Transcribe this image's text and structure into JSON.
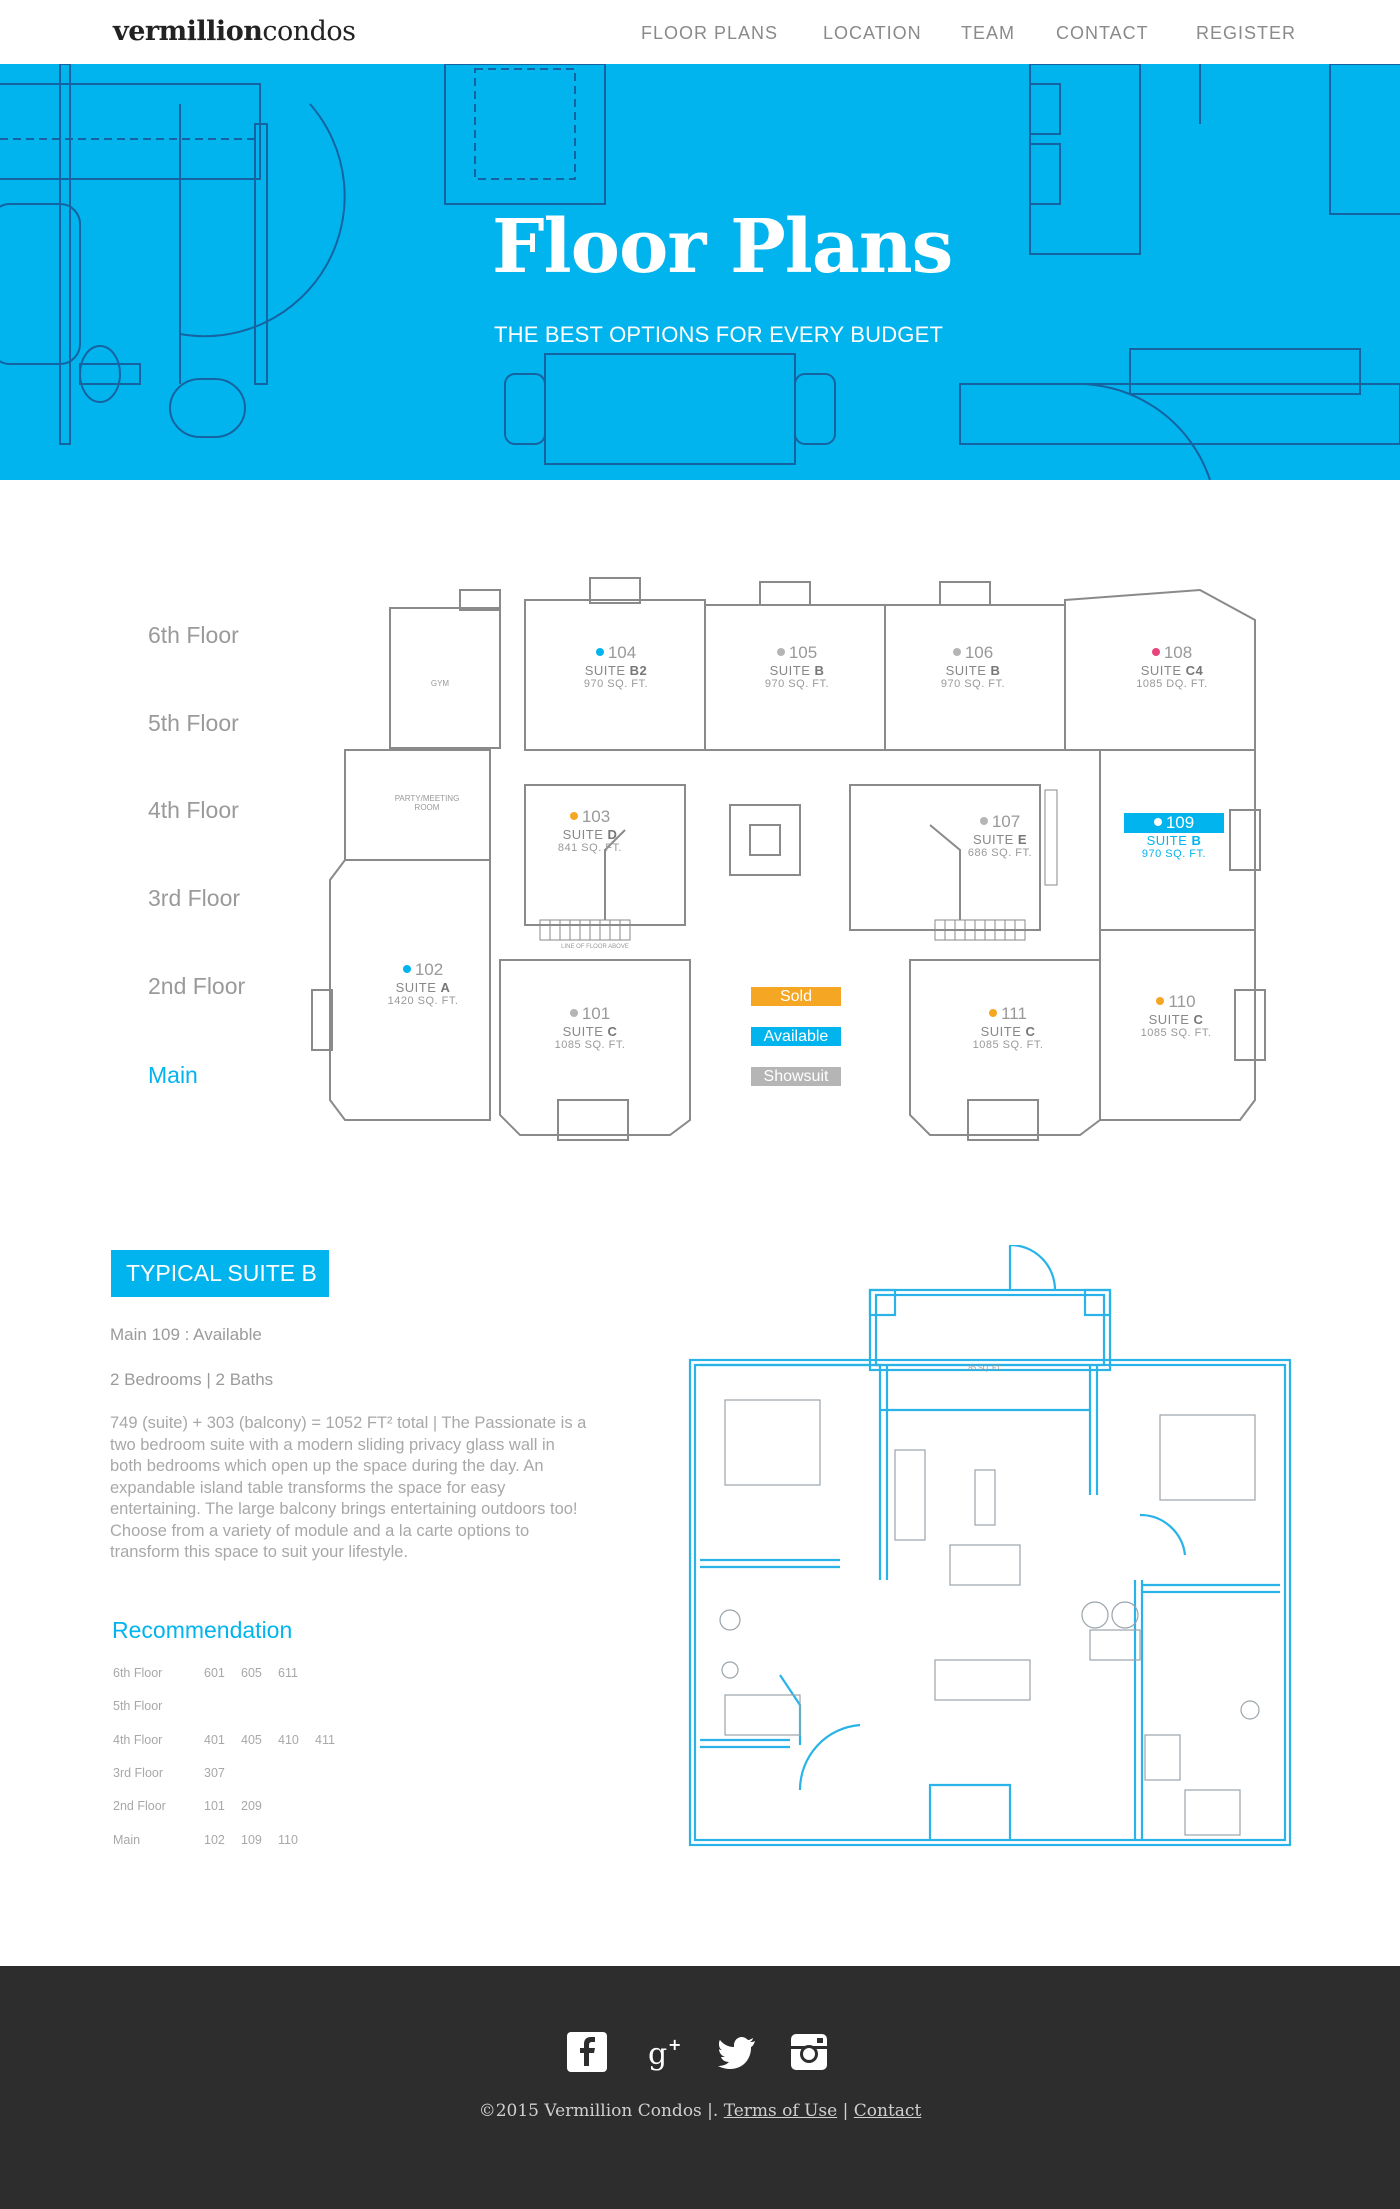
{
  "brand": {
    "logo_bold": "vermillion",
    "logo_light": "condos"
  },
  "nav": [
    {
      "label": "FLOOR PLANS"
    },
    {
      "label": "LOCATION"
    },
    {
      "label": "TEAM"
    },
    {
      "label": "CONTACT"
    },
    {
      "label": "REGISTER"
    }
  ],
  "hero": {
    "title": "Floor Plans",
    "subtitle": "THE BEST OPTIONS FOR EVERY BUDGET"
  },
  "floors": [
    "6th Floor",
    "5th Floor",
    "4th Floor",
    "3rd Floor",
    "2nd Floor",
    "Main"
  ],
  "active_floor": "Main",
  "units": [
    {
      "num": "104",
      "suite_prefix": "SUITE ",
      "suite_letter": "B2",
      "sq": "970 SQ. FT.",
      "status": "available"
    },
    {
      "num": "105",
      "suite_prefix": "SUITE ",
      "suite_letter": "B",
      "sq": "970 SQ. FT.",
      "status": "showsuite"
    },
    {
      "num": "106",
      "suite_prefix": "SUITE ",
      "suite_letter": "B",
      "sq": "970 SQ. FT.",
      "status": "showsuite"
    },
    {
      "num": "108",
      "suite_prefix": "SUITE ",
      "suite_letter": "C4",
      "sq": "1085 DQ. FT.",
      "status": "pink"
    },
    {
      "num": "103",
      "suite_prefix": "SUITE ",
      "suite_letter": "D",
      "sq": "841 SQ. FT.",
      "status": "sold"
    },
    {
      "num": "107",
      "suite_prefix": "SUITE ",
      "suite_letter": "E",
      "sq": "686 SQ. FT.",
      "status": "showsuite"
    },
    {
      "num": "109",
      "suite_prefix": "SUITE ",
      "suite_letter": "B",
      "sq": "970 SQ. FT.",
      "status": "selected"
    },
    {
      "num": "102",
      "suite_prefix": "SUITE ",
      "suite_letter": "A",
      "sq": "1420  SQ. FT.",
      "status": "available"
    },
    {
      "num": "101",
      "suite_prefix": "SUITE ",
      "suite_letter": "C",
      "sq": "1085 SQ. FT.",
      "status": "showsuite"
    },
    {
      "num": "111",
      "suite_prefix": "SUITE ",
      "suite_letter": "C",
      "sq": "1085 SQ. FT.",
      "status": "sold"
    },
    {
      "num": "110",
      "suite_prefix": "SUITE ",
      "suite_letter": "C",
      "sq": "1085 SQ. FT.",
      "status": "sold"
    }
  ],
  "rooms": {
    "gym": "GYM",
    "party": "PARTY/MEETING ROOM",
    "stairs_note": "LINE OF FLOOR ABOVE"
  },
  "legend": {
    "sold": "Sold",
    "available": "Available",
    "showsuite": "Showsuit"
  },
  "status_colors": {
    "sold": "#f5a623",
    "available": "#02b4ee",
    "showsuite": "#b5b5b5",
    "pink": "#e8457a"
  },
  "suite": {
    "badge": "TYPICAL SUITE B",
    "location_line": "Main  109 :   Available",
    "rooms_line": "2 Bedrooms | 2 Baths",
    "description": "749 (suite) + 303 (balcony) = 1052 FT² total | The Passionate is a two bedroom suite with a modern sliding privacy glass wall in both bedrooms which open up the space during the day. An expandable island table transforms the space for easy entertaining. The large balcony brings entertaining outdoors too! Choose from a variety of module and a la carte options to transform this space to suit your lifestyle.",
    "balcony_label": "85 SQ. FT."
  },
  "recommendation": {
    "title": "Recommendation",
    "rows": [
      {
        "floor": "6th Floor",
        "units": [
          "601",
          "605",
          "611"
        ]
      },
      {
        "floor": "5th Floor",
        "units": []
      },
      {
        "floor": "4th Floor",
        "units": [
          "401",
          "405",
          "410",
          "411"
        ]
      },
      {
        "floor": "3rd Floor",
        "units": [
          "307"
        ]
      },
      {
        "floor": "2nd Floor",
        "units": [
          "101",
          "209"
        ]
      },
      {
        "floor": "Main",
        "units": [
          "102",
          "109",
          "110"
        ]
      }
    ]
  },
  "footer": {
    "copyright": "©2015 Vermillion Condos |.",
    "terms": "Terms of Use",
    "separator": "|",
    "contact": "Contact",
    "social": [
      "facebook-icon",
      "google-plus-icon",
      "twitter-icon",
      "instagram-icon"
    ]
  }
}
